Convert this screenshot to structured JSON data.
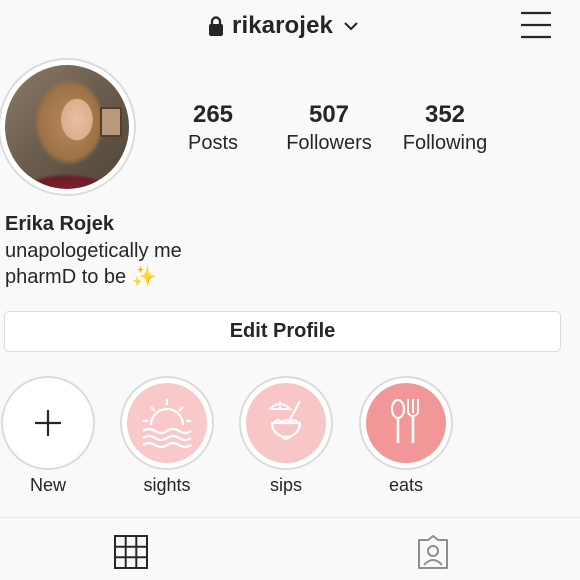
{
  "header": {
    "username": "rikarojek",
    "lock_icon": "lock-icon",
    "dropdown_icon": "chevron-down-icon",
    "menu_icon": "hamburger-menu-icon"
  },
  "profile": {
    "avatar_alt": "profile-photo"
  },
  "stats": [
    {
      "value": "265",
      "label": "Posts"
    },
    {
      "value": "507",
      "label": "Followers"
    },
    {
      "value": "352",
      "label": "Following"
    }
  ],
  "bio": {
    "name": "Erika Rojek",
    "line1": "unapologetically me",
    "line2": "pharmD to be",
    "line2_emoji": "✨"
  },
  "edit_profile_label": "Edit Profile",
  "highlights": [
    {
      "label": "New",
      "icon": "plus-icon"
    },
    {
      "label": "sights",
      "icon": "sunset-waves-icon",
      "color": "#f9c9c9"
    },
    {
      "label": "sips",
      "icon": "coconut-drink-icon",
      "color": "#f8c6c6"
    },
    {
      "label": "eats",
      "icon": "fork-spoon-icon",
      "color": "#f29797"
    }
  ],
  "tabs": [
    {
      "icon": "grid-icon",
      "active": true
    },
    {
      "icon": "tagged-icon",
      "active": false
    }
  ],
  "colors": {
    "background": "#f9f9f9",
    "text": "#262626",
    "border": "#dbdbdb",
    "icon_gray": "#8e8e8e"
  }
}
